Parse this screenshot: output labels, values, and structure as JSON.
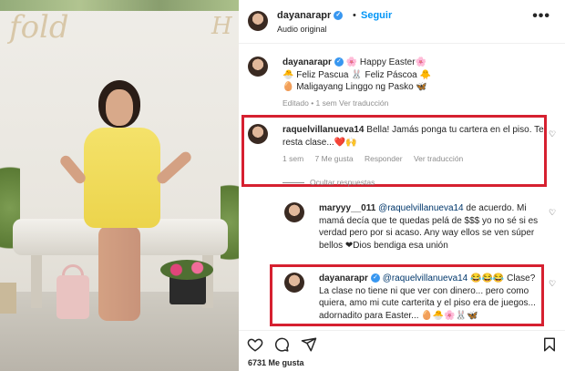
{
  "header": {
    "username": "dayanarapr",
    "separator": "•",
    "follow_label": "Seguir",
    "audio": "Audio original",
    "more": "•••"
  },
  "caption": {
    "username": "dayanarapr",
    "line1": "🌸 Happy Easter🌸",
    "line2": "🐣 Feliz Pascua 🐰 Feliz Páscoa 🐥",
    "line3": "🥚 Maligayang Linggo ng Pasko 🦋",
    "meta": "Editado • 1 sem    Ver traducción"
  },
  "comment1": {
    "username": "raquelvillanueva14",
    "text_l1": "Bella! Jamás ponga tu cartera en el piso. Te",
    "text_l2": "resta clase...❤️🙌",
    "time": "1 sem",
    "likes": "7 Me gusta",
    "reply": "Responder",
    "translate": "Ver traducción"
  },
  "replies_toggle": "Ocultar respuestas",
  "reply1": {
    "username": "maryyy__011",
    "mention": "@raquelvillanueva14",
    "text_l1": " de acuerdo. Mi",
    "text_l2": "mamá decía que te quedas pelá de $$$ yo no sé si es",
    "text_l3": "verdad pero por si acaso. Any way ellos se ven súper",
    "text_l4": "bellos ❤Dios bendiga esa unión"
  },
  "reply2": {
    "username": "dayanarapr",
    "mention": "@raquelvillanueva14",
    "text_l1": " 😂😂😂 Clase?",
    "text_l2": "La clase no tiene ni que ver con dinero... pero como",
    "text_l3": "quiera, amo mi cute carterita y el piso era de juegos...",
    "text_l4": "adornadito para Easter... 🥚🐣🌸🐰🦋"
  },
  "likes_count": "6731 Me gusta",
  "colors": {
    "accent": "#0095f6",
    "highlight_box": "#d62030",
    "meta": "#8e8e8e"
  },
  "icons": [
    "heart-icon",
    "comment-icon",
    "share-icon",
    "bookmark-icon",
    "more-icon",
    "verified-icon"
  ]
}
